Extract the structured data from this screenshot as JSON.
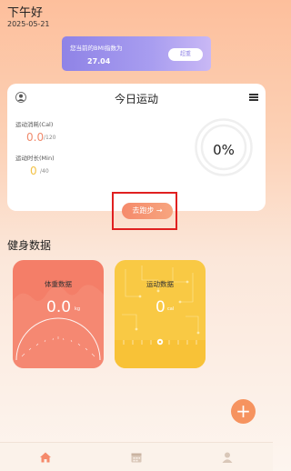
{
  "header": {
    "greeting": "下午好",
    "date": "2025-05-21"
  },
  "bmi": {
    "label": "您当前的BMI指数为",
    "value": "27.04",
    "status": "超重"
  },
  "today": {
    "title": "今日运动",
    "calorie": {
      "label": "运动消耗(Cal)",
      "value": "0.0",
      "goal": "/120"
    },
    "duration": {
      "label": "运动时长(Min)",
      "value": "0",
      "goal": "/40"
    },
    "progress": {
      "text": "0%",
      "fraction": 0
    },
    "run_button": "去跑步 →"
  },
  "health": {
    "title": "健身数据",
    "weight": {
      "title": "体重数据",
      "value": "0.0",
      "unit": "kg"
    },
    "sport": {
      "title": "运动数据",
      "value": "0",
      "unit": "cal"
    }
  },
  "fab": {
    "label": "+"
  },
  "tabbar": {
    "items": [
      {
        "icon": "home-icon"
      },
      {
        "icon": "calendar-icon"
      },
      {
        "icon": "person-icon"
      }
    ]
  },
  "colors": {
    "accent": "#f58a6b",
    "bmi_card": "#8f83e6",
    "weight_card": "#f47e68",
    "sport_card": "#f9c944",
    "highlight": "#e02020"
  }
}
